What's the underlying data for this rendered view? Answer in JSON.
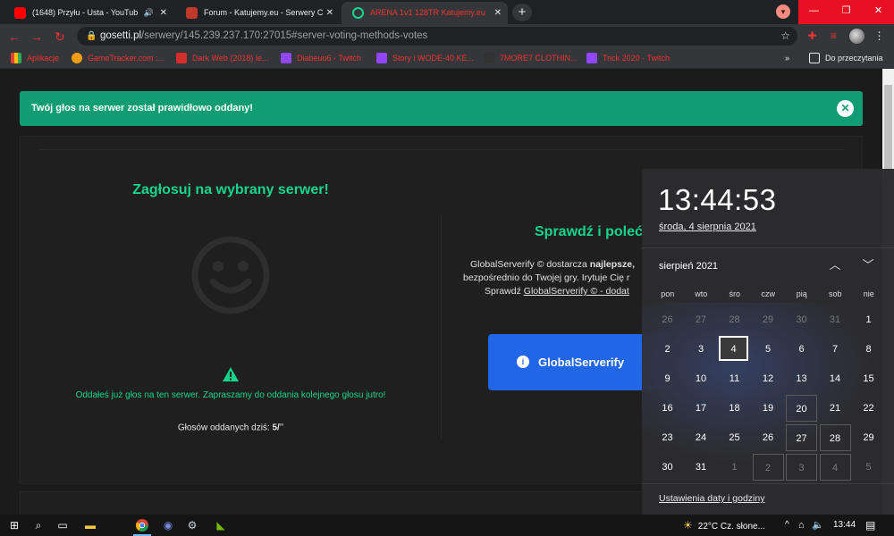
{
  "browser": {
    "tabs": [
      {
        "title": "(1648) Przyłu - Usta - YouTub",
        "favicon": "youtube-icon",
        "color": "#ff0000"
      },
      {
        "title": "Forum - Katujemy.eu - Serwery C",
        "favicon": "forum-icon",
        "color": "#c0392b"
      },
      {
        "title": "ARENA 1v1 128TR Katujemy.eu",
        "favicon": "globe-icon",
        "color": "#16d48c"
      }
    ],
    "new_tab": "+",
    "address": {
      "host": "gosetti.pl",
      "path": "/serwery/145.239.237.170:27015#server-voting-methods-votes"
    },
    "window_controls": {
      "minimize": "—",
      "restore": "❐",
      "close": "✕"
    }
  },
  "bookmarks": [
    {
      "label": "Aplikacje",
      "icon": "apps-grid-icon",
      "color": "#f4b400"
    },
    {
      "label": "GameTracker.com :...",
      "icon": "gametracker-icon",
      "color": "#f39c12"
    },
    {
      "label": "Dark Web (2018) le...",
      "icon": "cda-icon",
      "color": "#d32f2f"
    },
    {
      "label": "Diabeuu6 - Twitch",
      "icon": "twitch-icon",
      "color": "#9146ff"
    },
    {
      "label": "Story i WODE-40 KE...",
      "icon": "twitch-icon",
      "color": "#9146ff"
    },
    {
      "label": "7MORE7 CLOTHIN...",
      "icon": "7more7-icon",
      "color": "#333333"
    },
    {
      "label": "Trick 2020 - Twitch",
      "icon": "twitch-icon",
      "color": "#9146ff"
    }
  ],
  "bookmarks_more": "»",
  "reading_list": "Do przeczytania",
  "page": {
    "alert": "Twój głos na serwer został prawidłowo oddany!",
    "left_title": "Zagłosuj na wybrany serwer!",
    "voted_message": "Oddałeś już głos na ten serwer. Zapraszamy do oddania kolejnego głosu jutro!",
    "votes_today_label": "Głosów oddanych dziś:",
    "votes_today_value": "5/",
    "votes_today_suffix": "∞",
    "right_title": "Sprawdź i poleć",
    "right_text_1_prefix": "GlobalServerify © dostarcza",
    "right_text_1_bold": "najlepsze,",
    "right_text_2": "bezpośrednio do Twojej gry. Irytuje Cię r",
    "right_text_3_prefix": "Sprawdź",
    "right_text_3_link": "GlobalServerify © - dodat",
    "button_label": "GlobalServerify"
  },
  "colors": {
    "accent": "#16d48c",
    "alert": "#119c74",
    "button": "#2166e6"
  },
  "clock": {
    "time": "13:44:53",
    "long_date": "środa, 4 sierpnia 2021",
    "month": "sierpień 2021",
    "weekdays": [
      "pon",
      "wto",
      "śro",
      "czw",
      "pią",
      "sob",
      "nie"
    ],
    "weeks": [
      [
        "26",
        "27",
        "28",
        "29",
        "30",
        "31",
        "1"
      ],
      [
        "2",
        "3",
        "4",
        "5",
        "6",
        "7",
        "8"
      ],
      [
        "9",
        "10",
        "11",
        "12",
        "13",
        "14",
        "15"
      ],
      [
        "16",
        "17",
        "18",
        "19",
        "20",
        "21",
        "22"
      ],
      [
        "23",
        "24",
        "25",
        "26",
        "27",
        "28",
        "29"
      ],
      [
        "30",
        "31",
        "1",
        "2",
        "3",
        "4",
        "5"
      ]
    ],
    "dim_first_row_count": 6,
    "dim_last_row_from": 2,
    "today": "4",
    "settings_link": "Ustawienia daty i godziny"
  },
  "taskbar": {
    "weather": "22°C  Cz. słone...",
    "time": "13:44",
    "chevron": "^"
  }
}
